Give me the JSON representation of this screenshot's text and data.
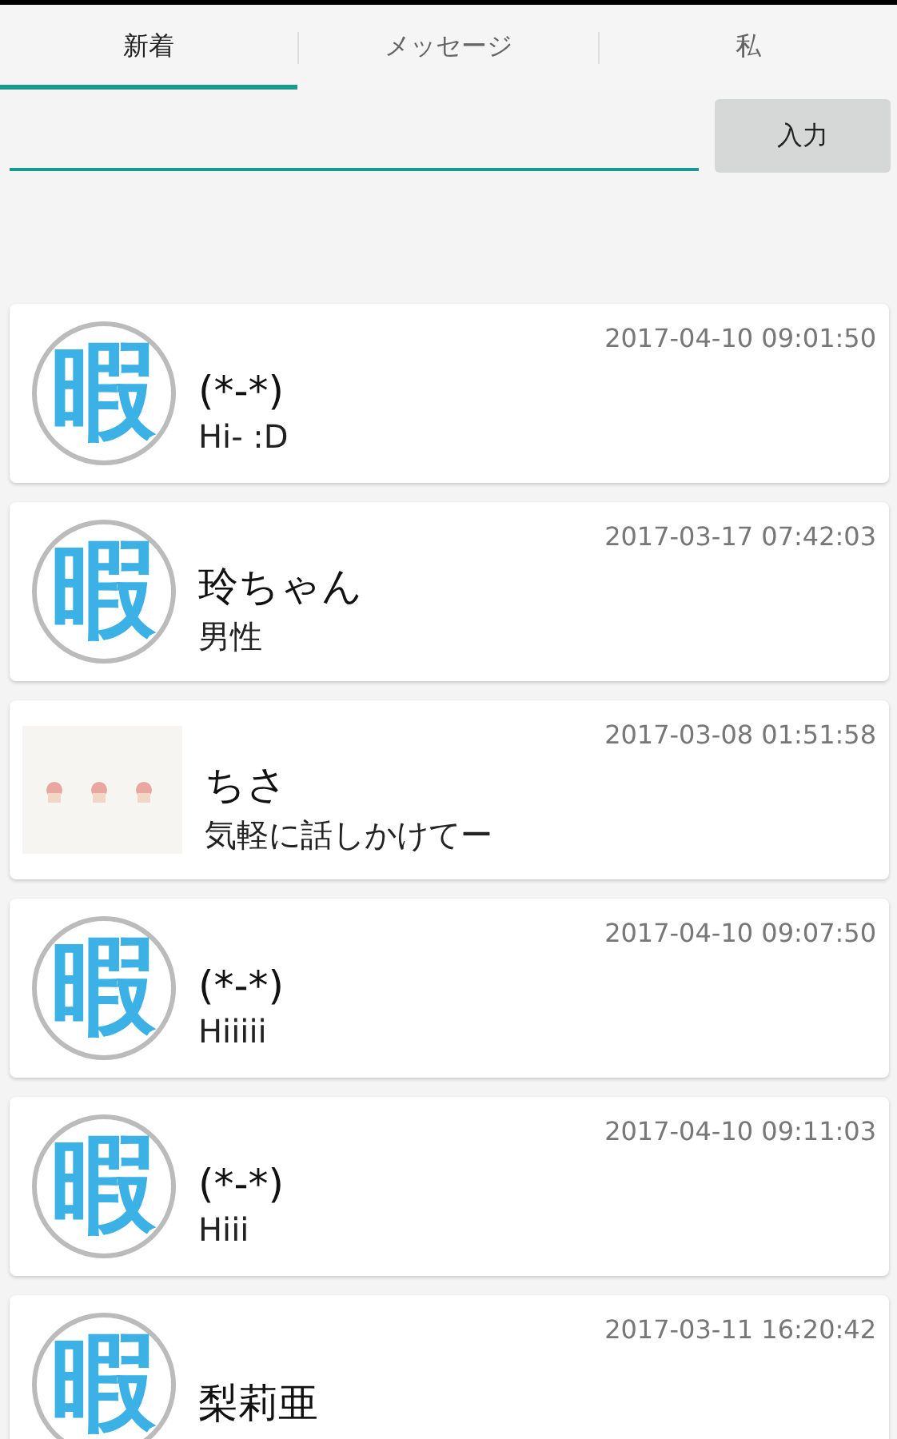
{
  "tabs": [
    {
      "label": "新着",
      "selected": true
    },
    {
      "label": "メッセージ",
      "selected": false
    },
    {
      "label": "私",
      "selected": false
    }
  ],
  "input": {
    "button": "入力"
  },
  "feed": [
    {
      "avatar": {
        "kind": "logo",
        "mark": "暇"
      },
      "time": "2017-04-10 09:01:50",
      "name": "(*-*)",
      "message": "Hi- :D"
    },
    {
      "avatar": {
        "kind": "logo",
        "mark": "暇"
      },
      "time": "2017-03-17 07:42:03",
      "name": "玲ちゃん",
      "message": "男性"
    },
    {
      "time": "2017-03-08 01:51:58",
      "name": "ちさ",
      "message": "気軽に話しかけてー"
    },
    {
      "avatar": {
        "kind": "logo",
        "mark": "暇"
      },
      "time": "2017-04-10 09:07:50",
      "name": "(*-*)",
      "message": "Hiiiii"
    },
    {
      "avatar": {
        "kind": "logo",
        "mark": "暇"
      },
      "time": "2017-04-10 09:11:03",
      "name": "(*-*)",
      "message": "Hiii"
    },
    {
      "avatar": {
        "kind": "logo",
        "mark": "暇"
      },
      "time": "2017-03-11 16:20:42",
      "name": "梨莉亜"
    }
  ]
}
